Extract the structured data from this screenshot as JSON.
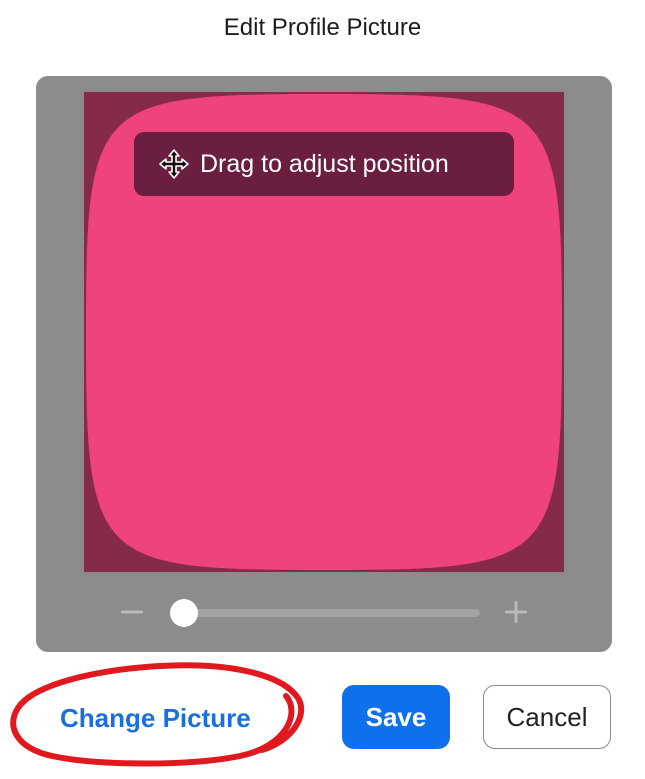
{
  "dialog": {
    "title": "Edit Profile Picture"
  },
  "editor": {
    "drag_hint": "Drag to adjust position",
    "drag_icon": "move-cursor-icon",
    "zoom": {
      "value": 0,
      "min": 0,
      "max": 1,
      "minus_icon": "minus-icon",
      "plus_icon": "plus-icon"
    },
    "colors": {
      "panel": "#8c8c8c",
      "background": "#852a4a",
      "picture": "#ef437b"
    }
  },
  "actions": {
    "change_picture": "Change Picture",
    "save": "Save",
    "cancel": "Cancel"
  },
  "annotation": {
    "color": "#e0191e"
  },
  "colors": {
    "accent": "#0e71eb",
    "link": "#1870dc"
  }
}
